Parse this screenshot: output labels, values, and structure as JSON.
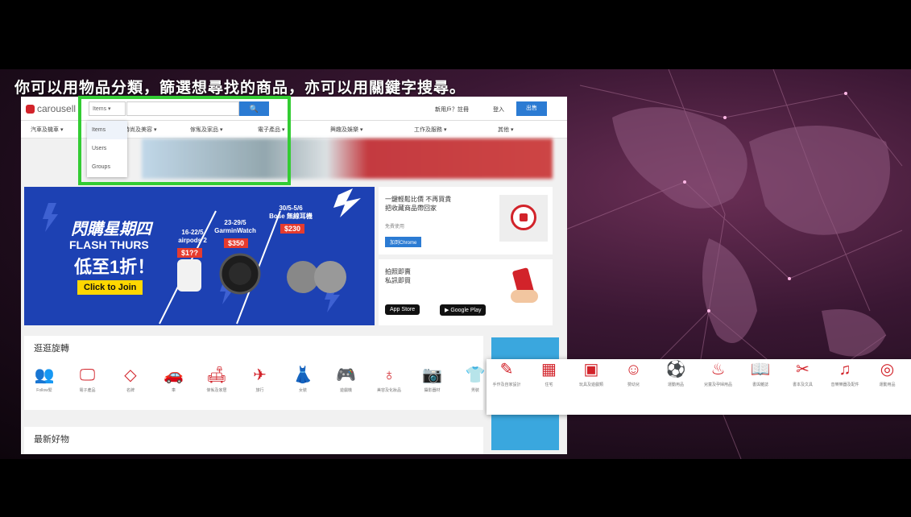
{
  "caption": "你可以用物品分類，篩選想尋找的商品，亦可以用關鍵字搜尋。",
  "header": {
    "logo": "carousell",
    "scope_select": "Items ▾",
    "search_icon": "search-icon",
    "register": "新用戶？註冊",
    "login": "登入",
    "sell": "出售"
  },
  "categories": [
    "汽車及機車 ▾",
    "時尚及美容 ▾",
    "傢俬及家品 ▾",
    "電子產品 ▾",
    "興趣及娛樂 ▾",
    "工作及服務 ▾",
    "其他 ▾"
  ],
  "dropdown": [
    "Items",
    "Users",
    "Groups"
  ],
  "flash": {
    "title": "閃購星期四",
    "sub": "FLASH THURS",
    "big": "低至1折！",
    "cta": "Click to Join",
    "p1": "16-22/5\nairpods 2",
    "p1price": "$1??",
    "p2": "23-29/5\nGarminWatch",
    "p2price": "$350",
    "p3": "30/5-5/6\nBose 無線耳機",
    "p3price": "$230"
  },
  "card1": {
    "title": "一鍵輕鬆比價 不再買貴\n把收藏商品帶回家",
    "sub": "免費使用",
    "button": "加到Chrome"
  },
  "card2": {
    "title": "拍照即賣\n私訊即買",
    "appstore": "App Store",
    "googleplay": "Google Play"
  },
  "section1": {
    "title": "逛逛旋轉"
  },
  "section2": {
    "title": "最新好物"
  },
  "icons_left": [
    {
      "icon": "follow-icon",
      "label": "Follow緊"
    },
    {
      "icon": "monitor-icon",
      "label": "電子產品"
    },
    {
      "icon": "diamond-icon",
      "label": "名牌"
    },
    {
      "icon": "car-icon",
      "label": "車"
    },
    {
      "icon": "sofa-icon",
      "label": "傢俬及家居"
    },
    {
      "icon": "plane-icon",
      "label": "旅行"
    },
    {
      "icon": "dress-icon",
      "label": "女裝"
    },
    {
      "icon": "gamepad-icon",
      "label": "遊戲機"
    },
    {
      "icon": "perfume-icon",
      "label": "美容及化妝品"
    },
    {
      "icon": "camera-icon",
      "label": "攝影器材"
    },
    {
      "icon": "shirt-icon",
      "label": "男裝"
    }
  ],
  "icons_right": [
    {
      "icon": "handmade-icon",
      "label": "手作及自家設計"
    },
    {
      "icon": "building-icon",
      "label": "住宅"
    },
    {
      "icon": "toys-icon",
      "label": "玩具及遊戲類"
    },
    {
      "icon": "baby-icon",
      "label": "嬰幼兒"
    },
    {
      "icon": "sports-icon",
      "label": "運動用品"
    },
    {
      "icon": "bottle-icon",
      "label": "兒童及孕婦用品"
    },
    {
      "icon": "book-icon",
      "label": "書與雜誌"
    },
    {
      "icon": "tools-icon",
      "label": "書本及文具"
    },
    {
      "icon": "music-icon",
      "label": "音樂樂器及配件"
    },
    {
      "icon": "ball-icon",
      "label": "運動用品"
    }
  ],
  "colors": {
    "accent": "#2b7bd3",
    "brand": "#d2232a",
    "highlight": "#33cc33"
  }
}
